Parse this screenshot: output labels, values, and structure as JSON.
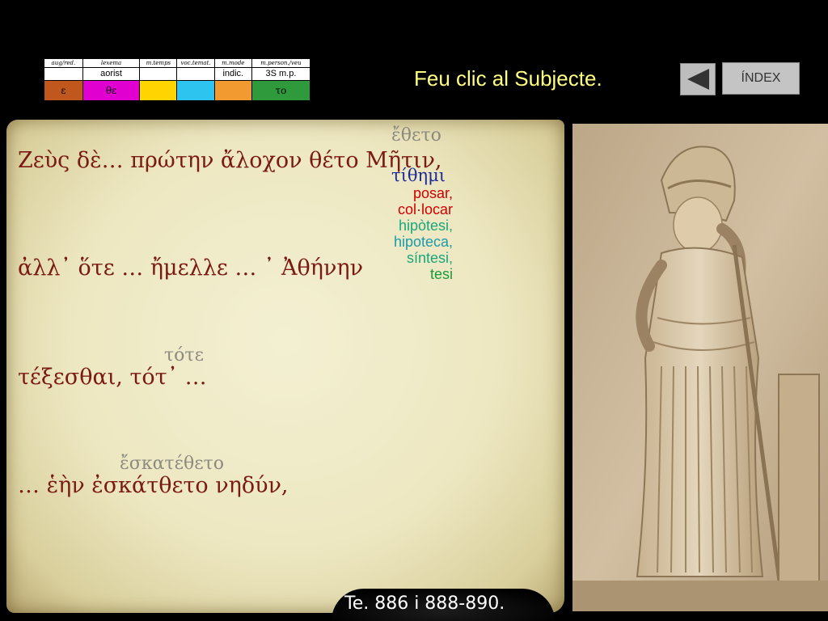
{
  "morph_table": {
    "headers": [
      "aug/red.",
      "lexema",
      "m.temps",
      "voc.temat.",
      "m.mode",
      "m.person./veu"
    ],
    "values": [
      "",
      "aorist",
      "",
      "",
      "indic.",
      "3S m.p."
    ],
    "cells": [
      {
        "text": "ε",
        "color": "#c0571c"
      },
      {
        "text": "θε",
        "color": "#e000d0"
      },
      {
        "text": "",
        "color": "#ffd400"
      },
      {
        "text": "",
        "color": "#2ec4f0"
      },
      {
        "text": "",
        "color": "#f29a30"
      },
      {
        "text": "το",
        "color": "#2e9a3c"
      }
    ]
  },
  "instruction": "Feu clic al Subjecte.",
  "nav": {
    "back_icon": "triangle-left-icon",
    "index_label": "ÍNDEX"
  },
  "text": {
    "line1": "Ζεὺς  δὲ… πρώτην  ἄλοχον  θέτο  Μῆτιν,",
    "line2": "ἀλλ᾽  ὅτε … ἤμελλε … ᾽ Ἀθήνην",
    "line3": "τέξεσθαι,  τότ᾽  …",
    "line4": "… ἑὴν  ἐσκάτθετο  νηδύν,",
    "gloss1": "ἔθετο",
    "lemma": "τίθημι",
    "gloss3": "τότε",
    "gloss4": "ἔσκατέθετο"
  },
  "translations": {
    "t1": "posar,",
    "t2": "col·locar",
    "t3": "hipòtesi,",
    "t4": "hipoteca,",
    "t5": "síntesi,",
    "t6": "tesi"
  },
  "reference": "Te. 886 i 888-890.",
  "colors": {
    "instruction": "#ffff80",
    "greek_text": "#7a1a12",
    "lemma": "#1a2a9a"
  }
}
